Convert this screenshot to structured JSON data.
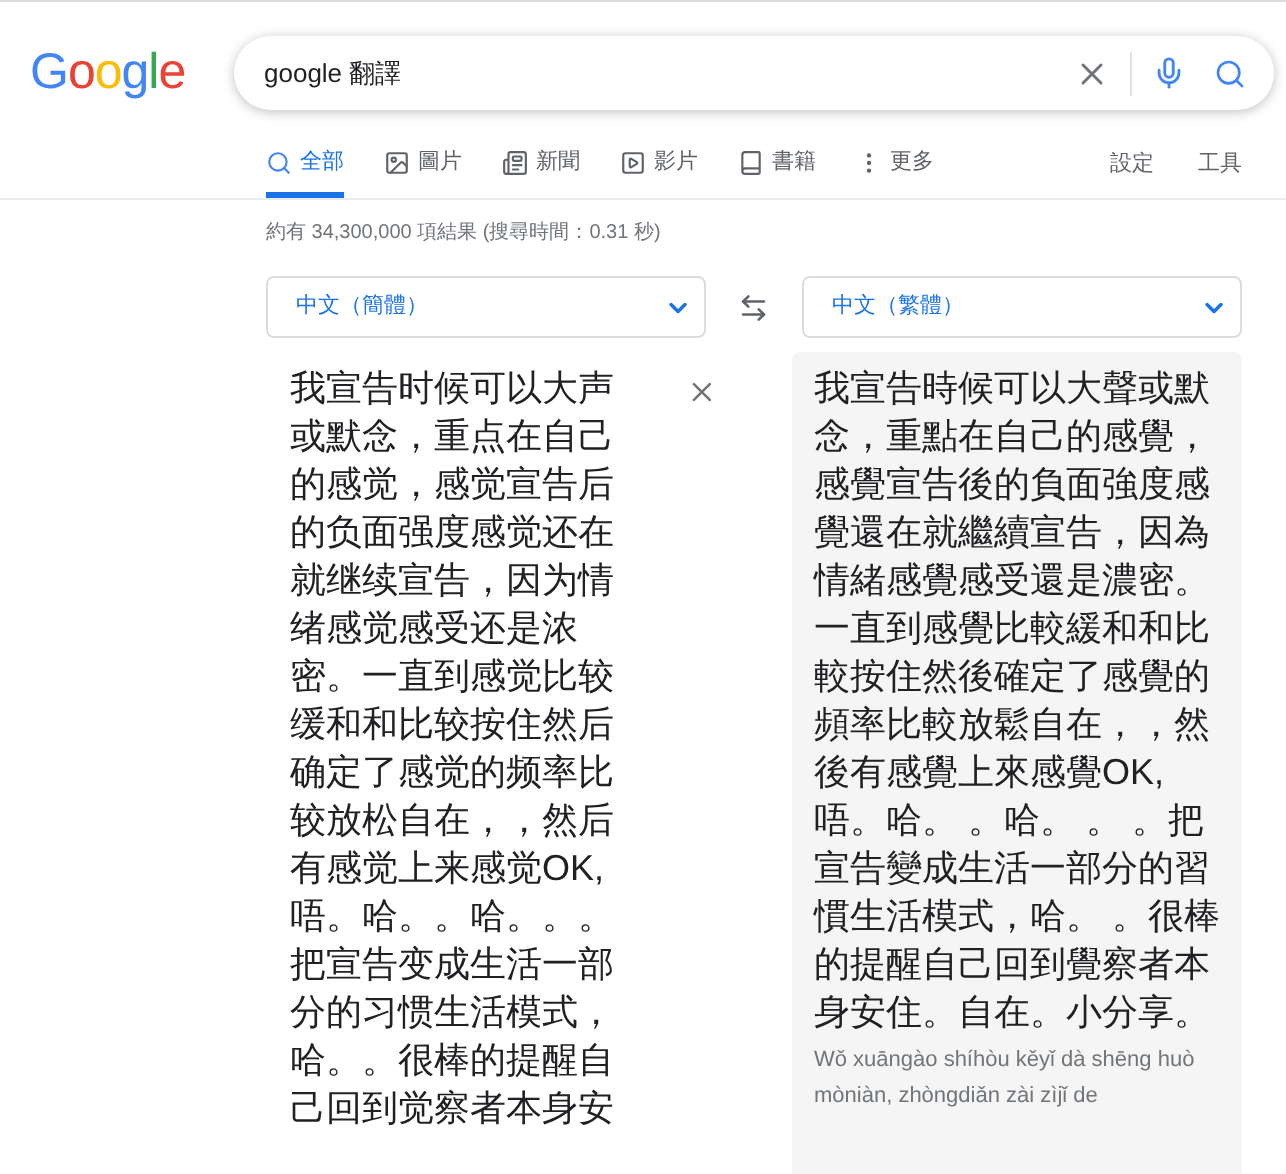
{
  "logo": "Google",
  "search": {
    "value": "google 翻譯"
  },
  "tabs": [
    {
      "kind": "all",
      "label": "全部",
      "selected": true
    },
    {
      "kind": "images",
      "label": "圖片",
      "selected": false
    },
    {
      "kind": "news",
      "label": "新聞",
      "selected": false
    },
    {
      "kind": "videos",
      "label": "影片",
      "selected": false
    },
    {
      "kind": "books",
      "label": "書籍",
      "selected": false
    },
    {
      "kind": "more",
      "label": "更多",
      "selected": false
    }
  ],
  "tools": [
    "設定",
    "工具"
  ],
  "result_stats": "約有 34,300,000 項結果 (搜尋時間：0.31 秒)",
  "translator": {
    "source_language": "中文（簡體）",
    "target_language": "中文（繁體）",
    "source_text": "我宣告时候可以大声或默念，重点在自己的感觉，感觉宣告后的负面强度感觉还在就继续宣告，因为情绪感觉感受还是浓密。一直到感觉比较缓和和比较按住然后确定了感觉的频率比较放松自在，，然后有感觉上来感觉OK,唔。哈。。哈。。。把宣告变成生活一部分的习惯生活模式，哈。。很棒的提醒自己回到觉察者本身安",
    "target_text": "我宣告時候可以大聲或默念，重點在自己的感覺，感覺宣告後的負面強度感覺還在就繼續宣告，因為情緒感覺感受還是濃密。一直到感覺比較緩和和比較按住然後確定了感覺的頻率比較放鬆自在，，然後有感覺上來感覺OK,唔。哈。 。哈。 。 。把宣告變成生活一部分的習慣生活模式，哈。 。很棒的提醒自己回到覺察者本身安住。自在。小分享。",
    "romanization": "Wǒ xuāngào shíhòu kěyǐ dà shēng huò mòniàn, zhòngdiǎn zài zìjǐ de"
  }
}
